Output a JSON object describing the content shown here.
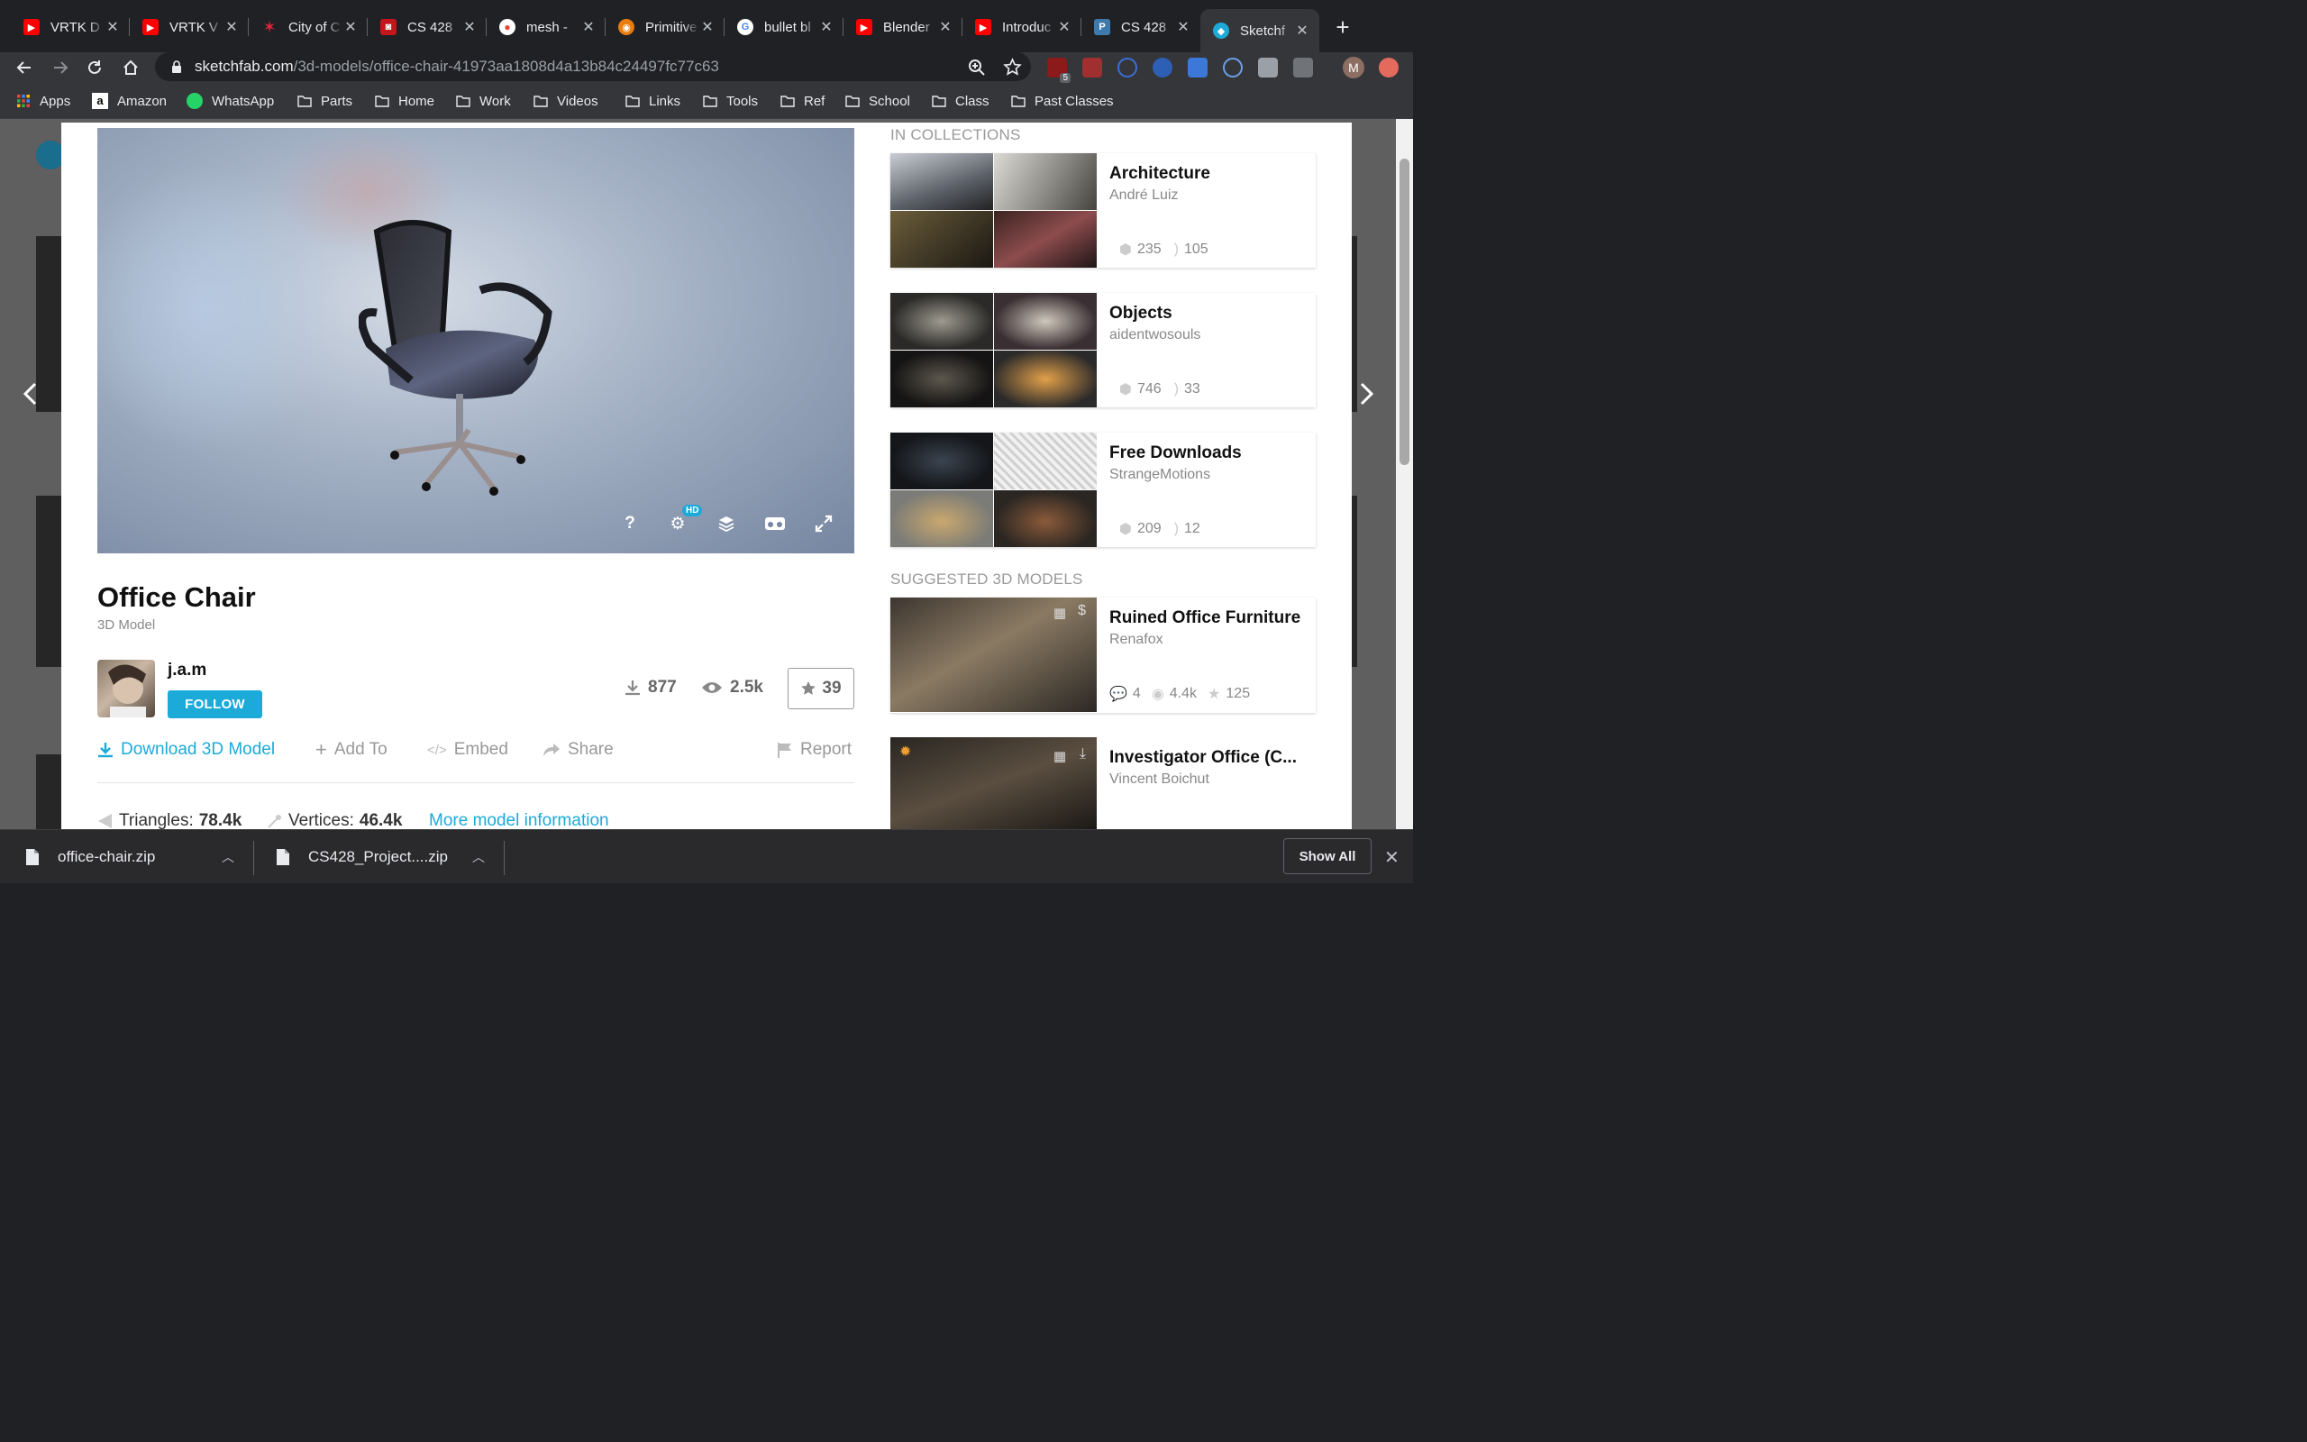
{
  "browser": {
    "tabs": [
      {
        "title": "VRTK D",
        "favicon": "youtube-icon"
      },
      {
        "title": "VRTK V",
        "favicon": "youtube-icon"
      },
      {
        "title": "City of C",
        "favicon": "chicago-star-icon"
      },
      {
        "title": "CS 428",
        "favicon": "piazza-icon"
      },
      {
        "title": "mesh -",
        "favicon": "maps-pin-icon"
      },
      {
        "title": "Primitive",
        "favicon": "blender-icon"
      },
      {
        "title": "bullet bl",
        "favicon": "google-icon"
      },
      {
        "title": "Blender",
        "favicon": "youtube-icon"
      },
      {
        "title": "Introduc",
        "favicon": "youtube-icon"
      },
      {
        "title": "CS 428",
        "favicon": "piazza-p-icon"
      },
      {
        "title": "Sketchf",
        "favicon": "sketchfab-icon",
        "active": true
      }
    ],
    "url_host": "sketchfab.com",
    "url_path": "/3d-models/office-chair-41973aa1808d4a13b84c24497fc77c63",
    "extension_badge": "5",
    "profile_initial": "M",
    "bookmarks": [
      "Apps",
      "Amazon",
      "WhatsApp",
      "Parts",
      "Home",
      "Work",
      "Videos",
      "Links",
      "Tools",
      "Ref",
      "School",
      "Class",
      "Past Classes"
    ]
  },
  "model": {
    "title": "Office Chair",
    "subtitle": "3D Model",
    "author": "j.a.m",
    "follow_label": "FOLLOW",
    "downloads": "877",
    "views": "2.5k",
    "likes": "39",
    "viewer_badge": "HD",
    "actions": {
      "download": "Download 3D Model",
      "add_to": "Add To",
      "embed": "Embed",
      "share": "Share",
      "report": "Report"
    },
    "triangles_label": "Triangles:",
    "triangles": "78.4k",
    "vertices_label": "Vertices:",
    "vertices": "46.4k",
    "more_info": "More model information"
  },
  "collections": {
    "heading": "IN COLLECTIONS",
    "items": [
      {
        "name": "Architecture",
        "owner": "André Luiz",
        "models": "235",
        "followers": "105"
      },
      {
        "name": "Objects",
        "owner": "aidentwosouls",
        "models": "746",
        "followers": "33"
      },
      {
        "name": "Free Downloads",
        "owner": "StrangeMotions",
        "models": "209",
        "followers": "12"
      }
    ]
  },
  "suggested": {
    "heading": "SUGGESTED 3D MODELS",
    "items": [
      {
        "name": "Ruined Office Furniture",
        "owner": "Renafox",
        "comments": "4",
        "views": "4.4k",
        "likes": "125"
      },
      {
        "name": "Investigator Office (C...",
        "owner": "Vincent Boichut"
      }
    ]
  },
  "downloads_bar": {
    "files": [
      "office-chair.zip",
      "CS428_Project....zip"
    ],
    "show_all": "Show All"
  }
}
